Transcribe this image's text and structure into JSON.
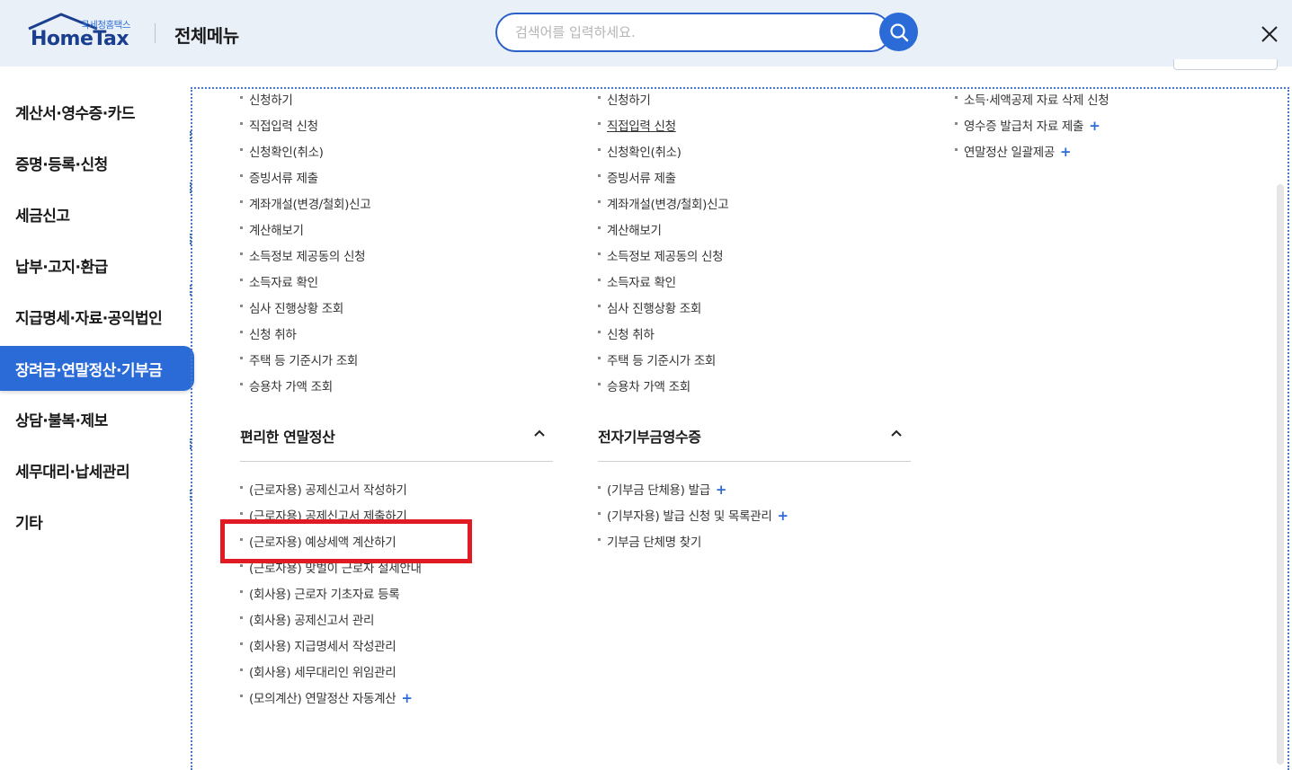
{
  "header": {
    "logo_sub": "국세청홈택스",
    "logo_main": "HomeTax",
    "title": "전체메뉴",
    "search_placeholder": "검색어를 입력하세요.",
    "search_icon": "search-icon",
    "close_icon": "close-icon"
  },
  "sidebar": {
    "items": [
      {
        "label": "계산서·영수증·카드"
      },
      {
        "label": "증명·등록·신청"
      },
      {
        "label": "세금신고"
      },
      {
        "label": "납부·고지·환급"
      },
      {
        "label": "지급명세·자료·공익법인"
      },
      {
        "label": "장려금·연말정산·기부금",
        "active": true
      },
      {
        "label": "상담·불복·제보"
      },
      {
        "label": "세무대리·납세관리"
      },
      {
        "label": "기타"
      }
    ]
  },
  "col1_links": [
    "신청하기",
    "직접입력 신청",
    "신청확인(취소)",
    "증빙서류 제출",
    "계좌개설(변경/철회)신고",
    "계산해보기",
    "소득정보 제공동의 신청",
    "소득자료 확인",
    "심사 진행상황 조회",
    "신청 취하",
    "주택 등 기준시가 조회",
    "승용차 가액 조회"
  ],
  "col2_links": [
    "신청하기",
    "직접입력 신청",
    "신청확인(취소)",
    "증빙서류 제출",
    "계좌개설(변경/철회)신고",
    "계산해보기",
    "소득정보 제공동의 신청",
    "소득자료 확인",
    "심사 진행상황 조회",
    "신청 취하",
    "주택 등 기준시가 조회",
    "승용차 가액 조회"
  ],
  "col3_links": [
    {
      "label": "소득·세액공제 자료 삭제 신청",
      "plus": false
    },
    {
      "label": "영수증 발급처 자료 제출",
      "plus": true
    },
    {
      "label": "연말정산 일괄제공",
      "plus": true
    }
  ],
  "section_easy": {
    "title": "편리한 연말정산",
    "links": [
      {
        "label": "(근로자용) 공제신고서 작성하기",
        "plus": false
      },
      {
        "label": "(근로자용) 공제신고서 제출하기",
        "plus": false
      },
      {
        "label": "(근로자용) 예상세액 계산하기",
        "plus": false,
        "highlighted": true
      },
      {
        "label": "(근로자용) 맞벌이 근로자 절세안내",
        "plus": false
      },
      {
        "label": "(회사용) 근로자 기초자료 등록",
        "plus": false
      },
      {
        "label": "(회사용) 공제신고서 관리",
        "plus": false
      },
      {
        "label": "(회사용) 지급명세서 작성관리",
        "plus": false
      },
      {
        "label": "(회사용) 세무대리인 위임관리",
        "plus": false
      },
      {
        "label": "(모의계산) 연말정산 자동계산",
        "plus": true
      }
    ]
  },
  "section_donation": {
    "title": "전자기부금영수증",
    "links": [
      {
        "label": "(기부금 단체용) 발급",
        "plus": true
      },
      {
        "label": "(기부자용) 발급 신청 및 목록관리",
        "plus": true
      },
      {
        "label": "기부금 단체명 찾기",
        "plus": false
      }
    ]
  },
  "plus_sign": "+",
  "colors": {
    "accent": "#2b6bd8",
    "highlight": "#e01b24"
  }
}
